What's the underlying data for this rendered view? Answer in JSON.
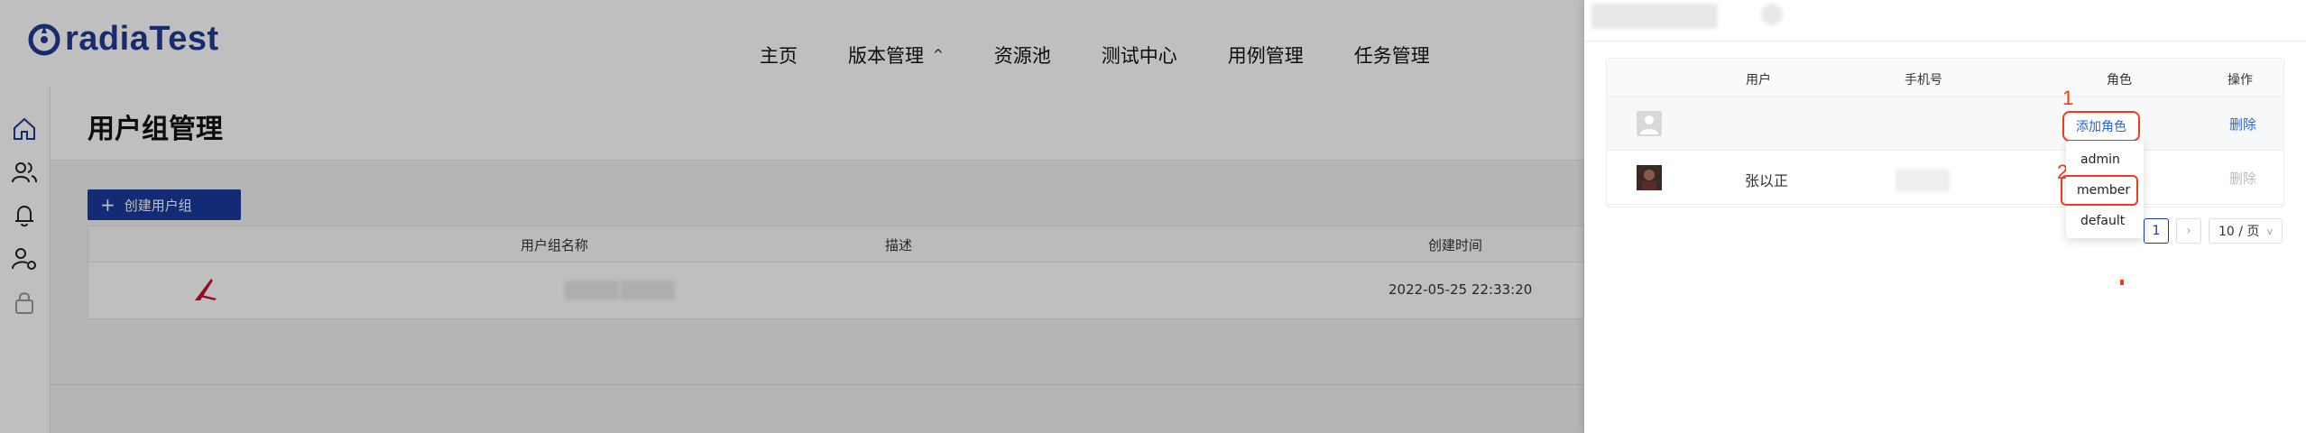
{
  "app": {
    "logo_text": "radiaTest"
  },
  "nav": {
    "items": [
      "主页",
      "版本管理",
      "资源池",
      "测试中心",
      "用例管理",
      "任务管理"
    ]
  },
  "page": {
    "title": "用户组管理",
    "create_button_label": "创建用户组",
    "table": {
      "headers": [
        "用户组名称",
        "描述",
        "创建时间"
      ],
      "rows": [
        {
          "created_at": "2022-05-25 22:33:20"
        }
      ]
    }
  },
  "drawer": {
    "table": {
      "headers": [
        "用户",
        "手机号",
        "角色",
        "操作"
      ],
      "rows": [
        {
          "user": "",
          "action": "删除"
        },
        {
          "user": "张以正",
          "action": "删除"
        }
      ],
      "add_role_label": "添加角色"
    },
    "role_menu": {
      "options": [
        "admin",
        "member",
        "default"
      ]
    },
    "annotations": [
      "1",
      "2"
    ],
    "pagination": {
      "current_page": "1",
      "page_size": "10 / 页"
    }
  },
  "colors": {
    "brand": "#1a3a9c",
    "logo": "#1f3a93",
    "link": "#2a64d8",
    "annotation": "#ef3b1c"
  },
  "icons": {
    "sidebar": [
      "home-icon",
      "users-icon",
      "bell-icon",
      "user-settings-icon",
      "lock-icon"
    ]
  }
}
